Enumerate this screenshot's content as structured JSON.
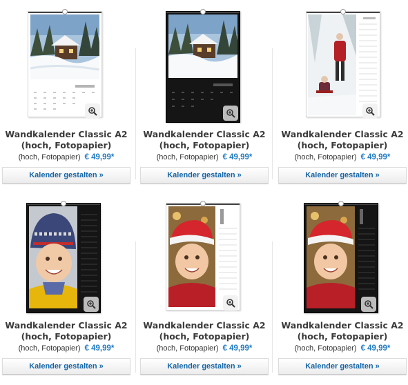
{
  "products": [
    {
      "title_line1": "Wandkalender Classic A2",
      "title_line2": "(hoch, Fotopapier)",
      "subtitle": "(hoch, Fotopapier)",
      "price": "€ 49,99*",
      "cta": "Kalender gestalten »",
      "style": "white",
      "motif": "winter-house",
      "month_label": "Januar  2013"
    },
    {
      "title_line1": "Wandkalender Classic A2",
      "title_line2": "(hoch, Fotopapier)",
      "subtitle": "(hoch, Fotopapier)",
      "price": "€ 49,99*",
      "cta": "Kalender gestalten »",
      "style": "black",
      "motif": "winter-house",
      "month_label": "Januar  2013"
    },
    {
      "title_line1": "Wandkalender Classic A2",
      "title_line2": "(hoch, Fotopapier)",
      "subtitle": "(hoch, Fotopapier)",
      "price": "€ 49,99*",
      "cta": "Kalender gestalten »",
      "style": "white-strip",
      "motif": "sled"
    },
    {
      "title_line1": "Wandkalender Classic A2",
      "title_line2": "(hoch, Fotopapier)",
      "subtitle": "(hoch, Fotopapier)",
      "price": "€ 49,99*",
      "cta": "Kalender gestalten »",
      "style": "black-strip",
      "motif": "boy-hat"
    },
    {
      "title_line1": "Wandkalender Classic A2",
      "title_line2": "(hoch, Fotopapier)",
      "subtitle": "(hoch, Fotopapier)",
      "price": "€ 49,99*",
      "cta": "Kalender gestalten »",
      "style": "white-strip",
      "motif": "child-santa"
    },
    {
      "title_line1": "Wandkalender Classic A2",
      "title_line2": "(hoch, Fotopapier)",
      "subtitle": "(hoch, Fotopapier)",
      "price": "€ 49,99*",
      "cta": "Kalender gestalten »",
      "style": "black-strip",
      "motif": "child-santa"
    }
  ],
  "icons": {
    "zoom": "magnifier-plus-icon"
  },
  "colors": {
    "price": "#1f7ac2",
    "cta_text": "#1565a8",
    "title": "#3b3b3b"
  }
}
